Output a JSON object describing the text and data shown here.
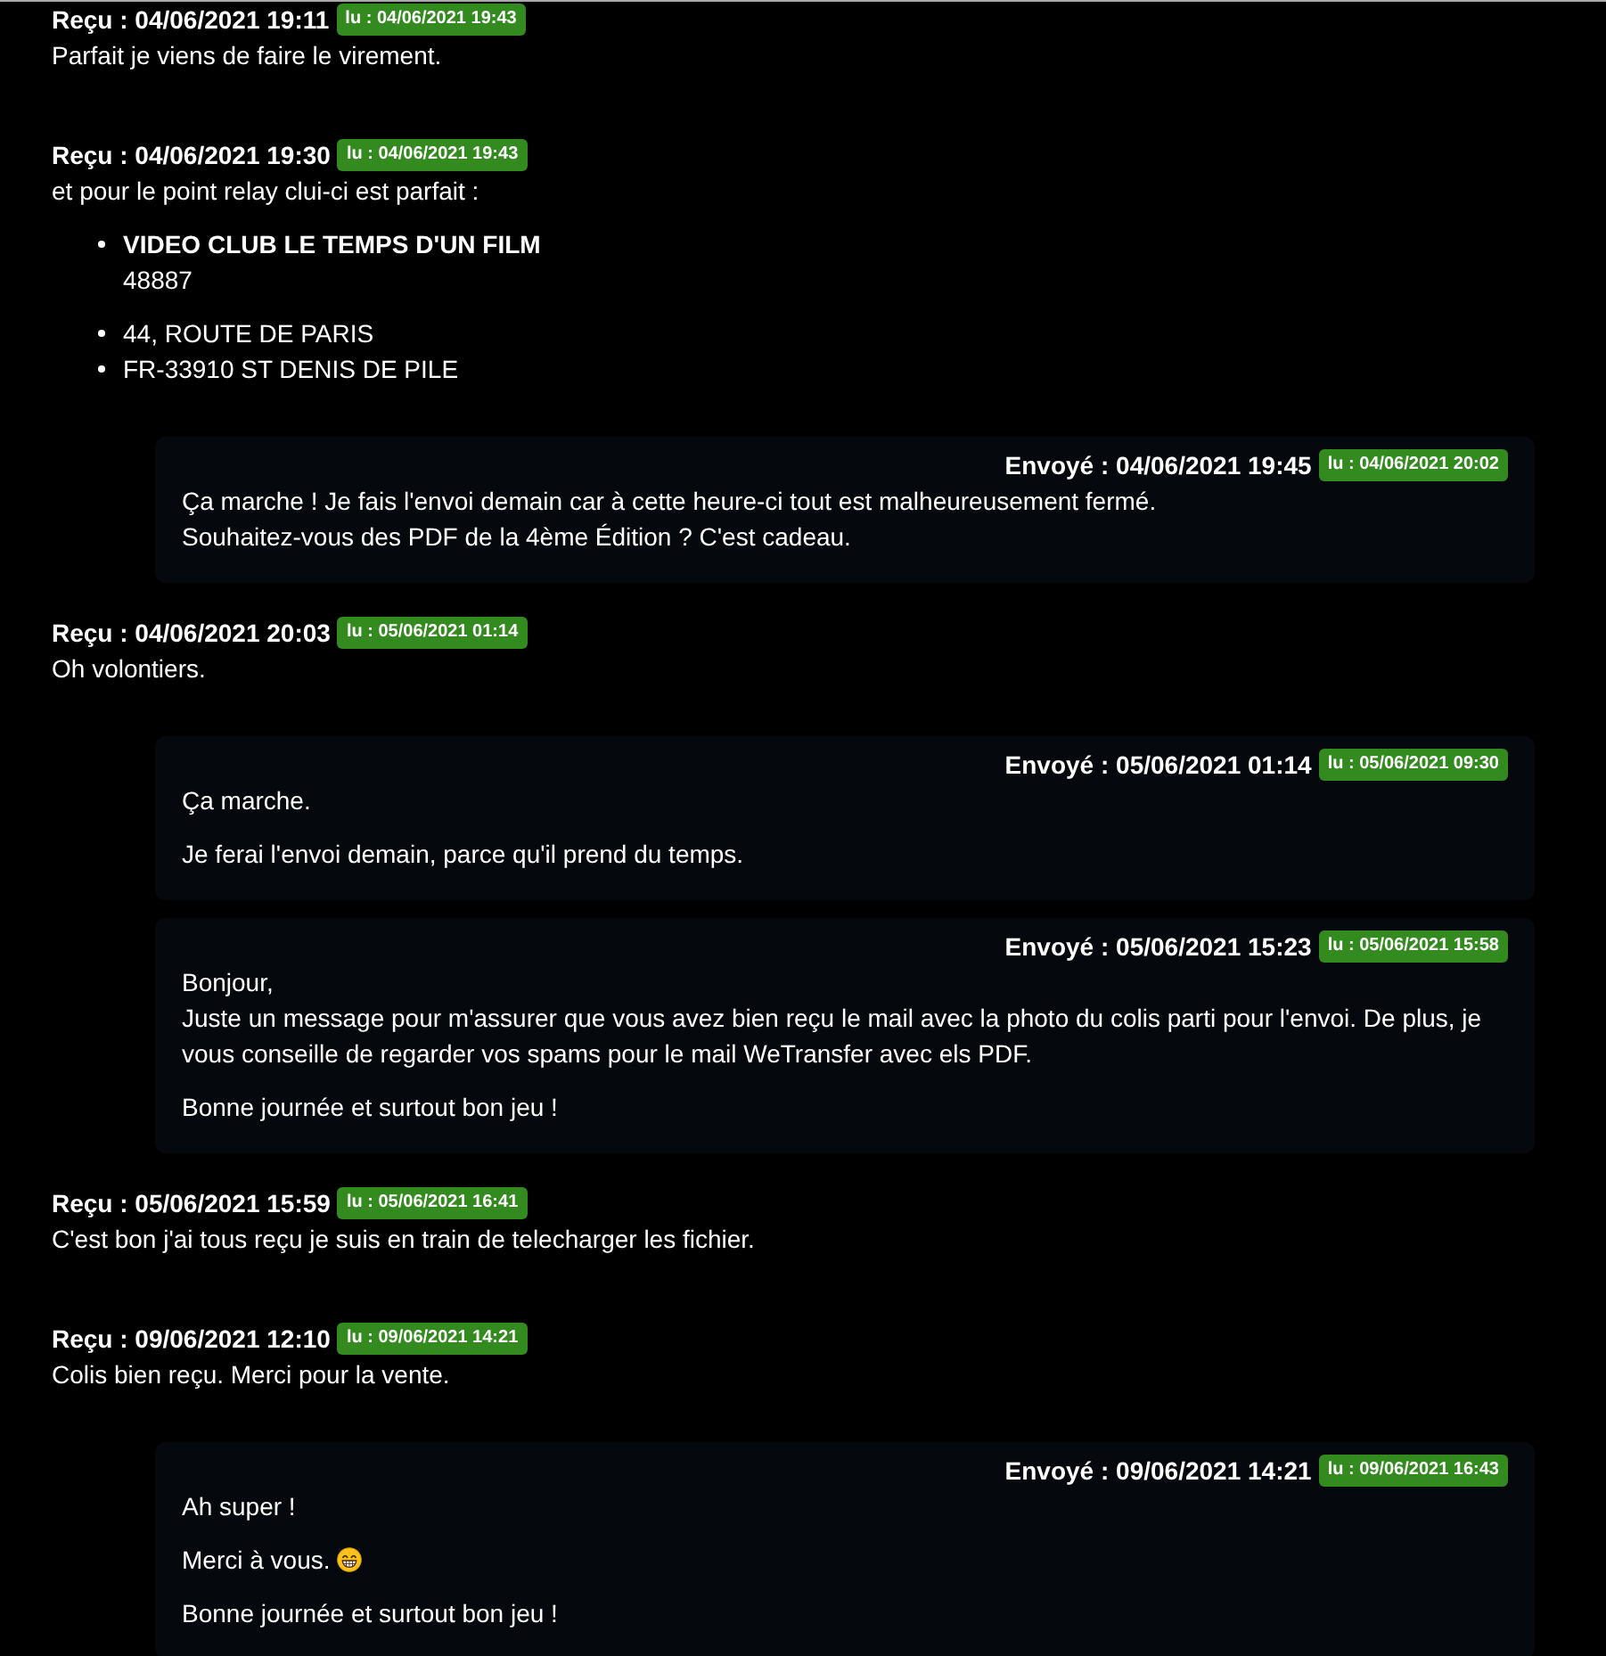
{
  "messages": [
    {
      "kind": "received",
      "header": "Reçu : 04/06/2021 19:11",
      "read_badge": "lu : 04/06/2021 19:43",
      "paragraphs": [
        {
          "lines": [
            "Parfait je viens de faire le virement."
          ]
        }
      ]
    },
    {
      "kind": "received",
      "header": "Reçu : 04/06/2021 19:30",
      "read_badge": "lu : 04/06/2021 19:43",
      "paragraphs": [
        {
          "lines": [
            "et pour le point relay clui-ci est parfait :"
          ]
        }
      ],
      "list": [
        {
          "lines": [
            "**VIDEO CLUB LE TEMPS D'UN FILM**",
            "48887"
          ]
        },
        {
          "lines": [
            "44, ROUTE DE PARIS"
          ]
        },
        {
          "lines": [
            "FR-33910 ST DENIS DE PILE"
          ]
        }
      ]
    },
    {
      "kind": "sent",
      "header": "Envoyé : 04/06/2021 19:45",
      "read_badge": "lu : 04/06/2021 20:02",
      "paragraphs": [
        {
          "lines": [
            "Ça marche ! Je fais l'envoi demain car à cette heure-ci tout est malheureusement fermé.",
            "Souhaitez-vous des PDF de la 4ème Édition ? C'est cadeau."
          ]
        }
      ]
    },
    {
      "kind": "received",
      "header": "Reçu : 04/06/2021 20:03",
      "read_badge": "lu : 05/06/2021 01:14",
      "paragraphs": [
        {
          "lines": [
            "Oh volontiers."
          ]
        }
      ]
    },
    {
      "kind": "sent",
      "header": "Envoyé : 05/06/2021 01:14",
      "read_badge": "lu : 05/06/2021 09:30",
      "paragraphs": [
        {
          "lines": [
            "Ça marche."
          ]
        },
        {
          "lines": [
            "Je ferai l'envoi demain, parce qu'il prend du temps."
          ]
        }
      ]
    },
    {
      "kind": "sent",
      "header": "Envoyé : 05/06/2021 15:23",
      "read_badge": "lu : 05/06/2021 15:58",
      "paragraphs": [
        {
          "lines": [
            "Bonjour,",
            "Juste un message pour m'assurer que vous avez bien reçu le mail avec la photo du colis parti pour l'envoi. De plus, je vous conseille de regarder vos spams pour le mail WeTransfer avec els PDF."
          ]
        },
        {
          "lines": [
            "Bonne journée et surtout bon jeu !"
          ]
        }
      ]
    },
    {
      "kind": "received",
      "header": "Reçu : 05/06/2021 15:59",
      "read_badge": "lu : 05/06/2021 16:41",
      "paragraphs": [
        {
          "lines": [
            "C'est bon j'ai tous reçu je suis en train de telecharger les fichier."
          ]
        }
      ]
    },
    {
      "kind": "received",
      "header": "Reçu : 09/06/2021 12:10",
      "read_badge": "lu : 09/06/2021 14:21",
      "paragraphs": [
        {
          "lines": [
            "Colis bien reçu. Merci pour la vente."
          ]
        }
      ]
    },
    {
      "kind": "sent",
      "header": "Envoyé : 09/06/2021 14:21",
      "read_badge": "lu : 09/06/2021 16:43",
      "paragraphs": [
        {
          "lines": [
            "Ah super !"
          ]
        },
        {
          "lines": [
            "Merci à vous."
          ],
          "emoji": true
        },
        {
          "lines": [
            "Bonne journée et surtout bon jeu !"
          ]
        }
      ]
    }
  ]
}
